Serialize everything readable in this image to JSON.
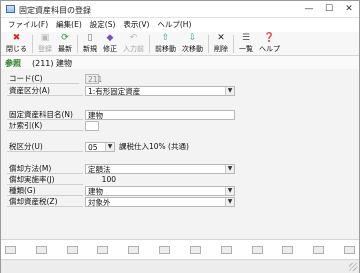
{
  "window": {
    "title": "固定資産科目の登録",
    "minimize": "—",
    "maximize": "☐",
    "close": "✕"
  },
  "menu": [
    "ファイル(F)",
    "編集(E)",
    "設定(S)",
    "表示(V)",
    "ヘルプ(H)"
  ],
  "toolbar": {
    "close": "閉じる",
    "register": "登録",
    "refresh": "最新",
    "new": "新規",
    "edit": "修正",
    "input_prev": "入力前",
    "prev": "前移動",
    "next": "次移動",
    "delete": "削除",
    "list": "一覧",
    "help": "ヘルプ"
  },
  "header": {
    "ref": "参照",
    "code": "(211) 建物"
  },
  "form": {
    "code_label": "コード(C)",
    "code_value": "211",
    "asset_class_label": "資産区分(A)",
    "asset_class_value": "1:有形固定資産",
    "item_name_label": "固定資産科目名(N)",
    "item_name_value": "建物",
    "kana_label": "ｶﾅ索引(K)",
    "kana_value": "",
    "tax_class_label": "税区分(U)",
    "tax_class_code": "05",
    "tax_class_desc": "課税仕入10% (共通)",
    "depr_method_label": "償却方法(M)",
    "depr_method_value": "定額法",
    "depr_rate_label": "償却実施率(J)",
    "depr_rate_value": "100",
    "kind_label": "種類(G)",
    "kind_value": "建物",
    "depr_tax_label": "償却資産税(Z)",
    "depr_tax_value": "対象外"
  },
  "colors": {
    "ref_text": "#2a7a2a",
    "toolbar_bg": "#f7f7f7",
    "window_bg": "#f3f3f3"
  }
}
